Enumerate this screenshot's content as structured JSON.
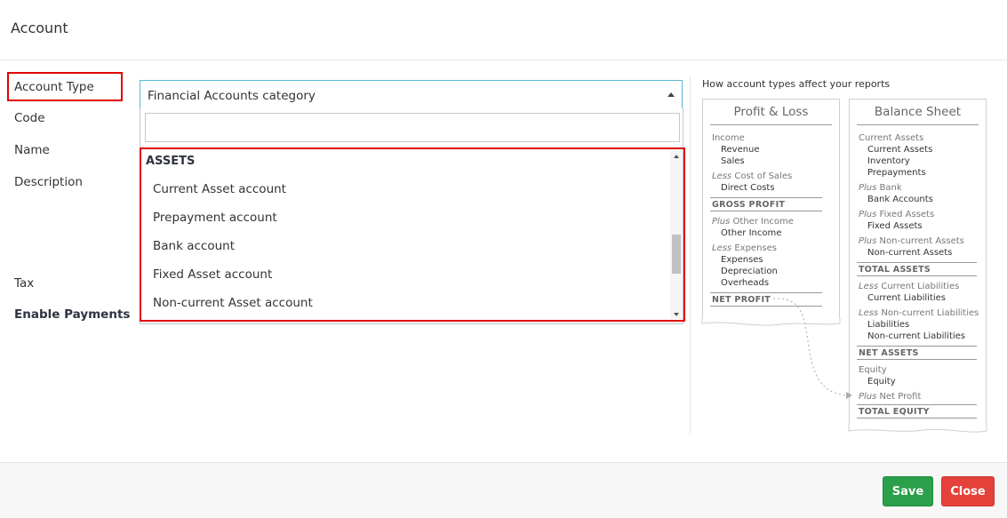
{
  "header": {
    "title": "Account"
  },
  "form": {
    "labels": {
      "account_type": "Account Type",
      "code": "Code",
      "name": "Name",
      "description": "Description",
      "tax": "Tax",
      "enable_payments": "Enable Payments"
    },
    "account_type_select": {
      "value": "Financial Accounts category",
      "search_placeholder": "",
      "group": "ASSETS",
      "options": [
        "Current Asset account",
        "Prepayment account",
        "Bank account",
        "Fixed Asset account",
        "Non-current Asset account"
      ]
    }
  },
  "help": {
    "title": "How account types affect your reports",
    "profit_loss": {
      "title": "Profit & Loss",
      "income": "Income",
      "revenue": "Revenue",
      "sales": "Sales",
      "less": "Less",
      "cost_of_sales": "Cost of Sales",
      "direct_costs": "Direct Costs",
      "gross_profit": "GROSS PROFIT",
      "plus": "Plus",
      "other_income_label": "Other Income",
      "other_income": "Other Income",
      "expenses_label": "Expenses",
      "expenses": "Expenses",
      "depreciation": "Depreciation",
      "overheads": "Overheads",
      "net_profit": "NET PROFIT"
    },
    "balance_sheet": {
      "title": "Balance Sheet",
      "current_assets_label": "Current Assets",
      "current_assets": "Current Assets",
      "inventory": "Inventory",
      "prepayments": "Prepayments",
      "plus": "Plus",
      "less": "Less",
      "bank_label": "Bank",
      "bank_accounts": "Bank Accounts",
      "fixed_assets_label": "Fixed Assets",
      "fixed_assets": "Fixed Assets",
      "noncurrent_assets_label": "Non-current Assets",
      "noncurrent_assets": "Non-current Assets",
      "total_assets": "TOTAL ASSETS",
      "current_liabilities_label": "Current Liabilities",
      "current_liabilities": "Current Liabilities",
      "noncurrent_liabilities_label": "Non-current Liabilities",
      "liabilities": "Liabilities",
      "noncurrent_liabilities": "Non-current Liabilities",
      "net_assets": "NET ASSETS",
      "equity_label": "Equity",
      "equity": "Equity",
      "net_profit_label": "Net Profit",
      "total_equity": "TOTAL EQUITY"
    }
  },
  "footer": {
    "save_label": "Save",
    "close_label": "Close"
  },
  "colors": {
    "save": "#2b9f4a",
    "close": "#e4423a",
    "highlight": "#e00000",
    "focus": "#5bb8d3"
  }
}
